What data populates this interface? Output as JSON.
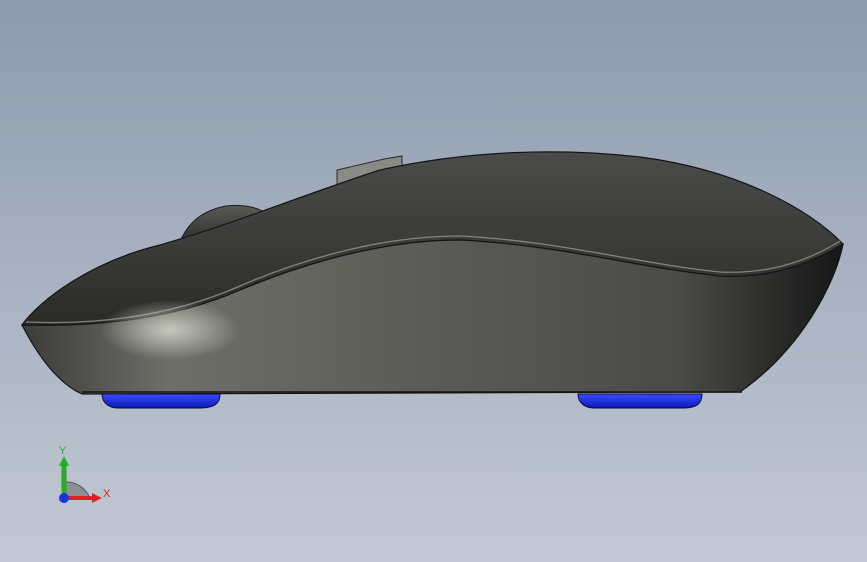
{
  "viewport": {
    "background_top": "#8d9bad",
    "background_bottom": "#c3c9d4"
  },
  "model": {
    "body_color": "#3f403e",
    "foot_color": "#1f2fe0"
  },
  "triad": {
    "x_label": "X",
    "y_label": "Y",
    "x_color": "#e02020",
    "y_color": "#22b022",
    "z_color": "#2030e0"
  }
}
